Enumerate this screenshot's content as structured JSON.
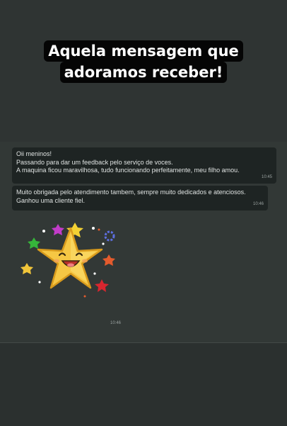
{
  "caption": {
    "line1": "Aquela mensagem que",
    "line2": "adoramos receber!"
  },
  "messages": [
    {
      "lines": [
        "Oii meninos!",
        "Passando para dar um feedback pelo serviço de voces.",
        "A maquina ficou maravilhosa, tudo funcionando perfeitamente, meu filho amou."
      ],
      "time": "10:45"
    },
    {
      "lines": [
        "Muito obrigada pelo atendimento tambem, sempre muito dedicados e atenciosos.",
        "Ganhou uma cliente fiel."
      ],
      "time": "10:46"
    }
  ],
  "sticker": {
    "icon": "happy-star-sticker-icon",
    "time": "10:46"
  },
  "colors": {
    "background": "#2e3332",
    "bubble": "#1e2423",
    "caption_bg": "#050505",
    "star": "#f6c744"
  }
}
